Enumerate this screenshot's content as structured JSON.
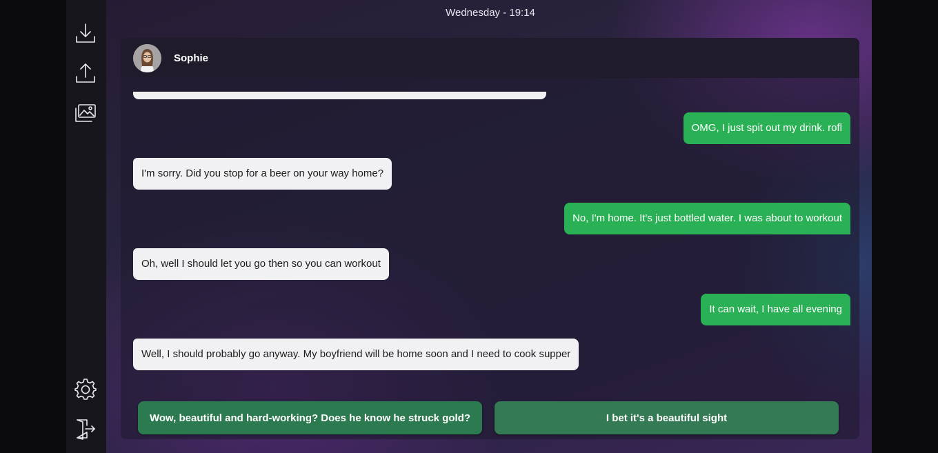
{
  "header": {
    "clock": "Wednesday - 19:14"
  },
  "sidebar": {
    "icons": [
      "download-icon",
      "upload-icon",
      "gallery-icon",
      "gear-icon",
      "exit-icon"
    ]
  },
  "chat": {
    "contact_name": "Sophie",
    "messages": [
      {
        "from": "me",
        "text": "OMG, I just spit out my drink. rofl"
      },
      {
        "from": "Sophie",
        "text": "I'm sorry. Did you stop for a beer on your way home?"
      },
      {
        "from": "me",
        "text": "No, I'm home. It's just bottled water. I was about to workout"
      },
      {
        "from": "Sophie",
        "text": "Oh, well I should let you go then so you can workout"
      },
      {
        "from": "me",
        "text": "It can wait, I have all evening"
      },
      {
        "from": "Sophie",
        "text": "Well, I should probably go anyway. My boyfriend will be home soon and I need to cook supper"
      }
    ],
    "choices": [
      "Wow, beautiful and hard-working? Does he know he struck gold?",
      "I bet it's a beautiful sight"
    ]
  },
  "colors": {
    "outgoing_bubble": "#2ab155",
    "incoming_bubble": "#f1f1f3",
    "choice_button": "#2c7a4f"
  }
}
